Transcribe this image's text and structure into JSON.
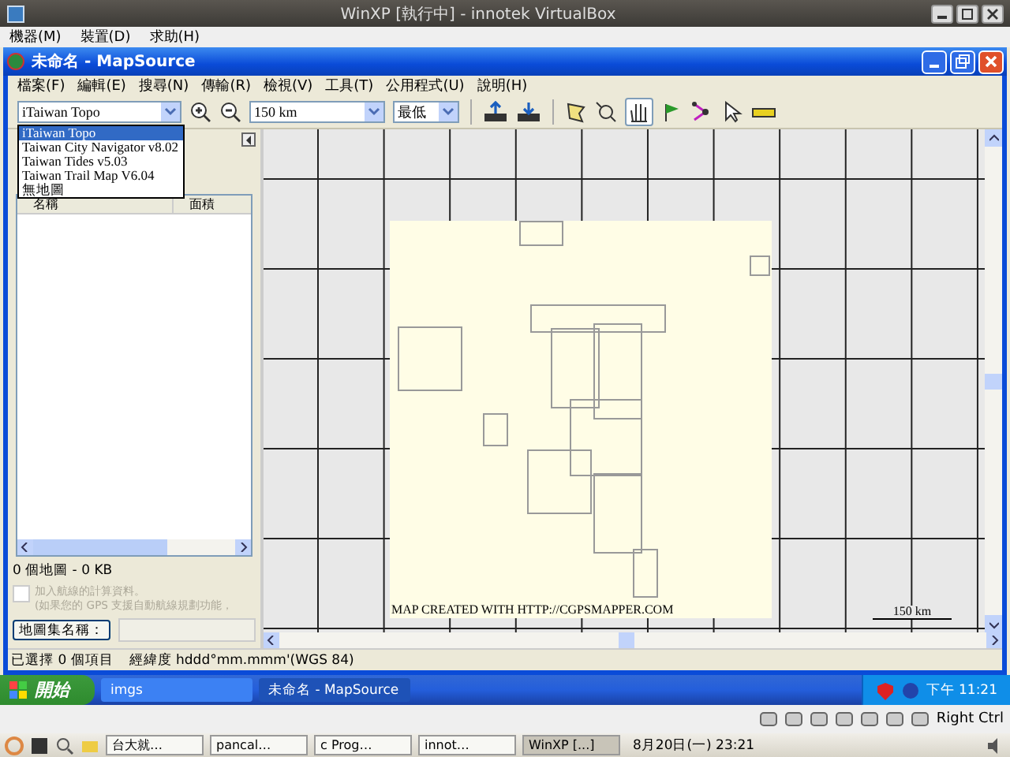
{
  "host_window": {
    "title": "WinXP [執行中] - innotek VirtualBox"
  },
  "host_menu": [
    "機器(M)",
    "裝置(D)",
    "求助(H)"
  ],
  "window": {
    "title": "未命名 - MapSource"
  },
  "menu": [
    "檔案(F)",
    "編輯(E)",
    "搜尋(N)",
    "傳輸(R)",
    "檢視(V)",
    "工具(T)",
    "公用程式(U)",
    "說明(H)"
  ],
  "toolbar": {
    "map_product": "iTaiwan Topo",
    "zoom": "150 km",
    "detail": "最低"
  },
  "map_product_dropdown": [
    {
      "label": "iTaiwan Topo",
      "selected": true
    },
    {
      "label": "Taiwan City Navigator v8.02",
      "selected": false
    },
    {
      "label": "Taiwan Tides v5.03",
      "selected": false
    },
    {
      "label": "Taiwan Trail Map V6.04",
      "selected": false
    },
    {
      "label": "無地圖",
      "selected": false
    }
  ],
  "map_list": {
    "columns": [
      "名稱",
      "面積"
    ]
  },
  "map_summary": "0 個地圖 - 0 KB",
  "route_option": {
    "label": "加入航線的計算資料。",
    "note": "(如果您的 GPS 支援自動航線規劃功能，",
    "checked": false,
    "disabled": true
  },
  "mapset_button": "地圖集名稱：",
  "map": {
    "credit": "MAP CREATED WITH HTTP://CGPSMAPPER.COM",
    "scale": "150 km"
  },
  "status_bar": [
    "已選擇 0 個項目",
    "經緯度 hddd°mm.mmm'(WGS 84)"
  ],
  "taskbar": {
    "start": "開始",
    "windows": [
      {
        "label": "imgs",
        "selected": false
      },
      {
        "label": "未命名 - MapSource",
        "selected": true
      }
    ],
    "clock": "下午 11:21"
  },
  "vm_status": {
    "host_key": "Right Ctrl"
  },
  "host_panel": {
    "windows": [
      {
        "label": "台大就…",
        "selected": false
      },
      {
        "label": "pancal…",
        "selected": false
      },
      {
        "label": "c Prog…",
        "selected": false
      },
      {
        "label": "innot…",
        "selected": false
      },
      {
        "label": "WinXP [...]",
        "selected": true
      }
    ],
    "clock": "8月20日(一) 23:21"
  }
}
